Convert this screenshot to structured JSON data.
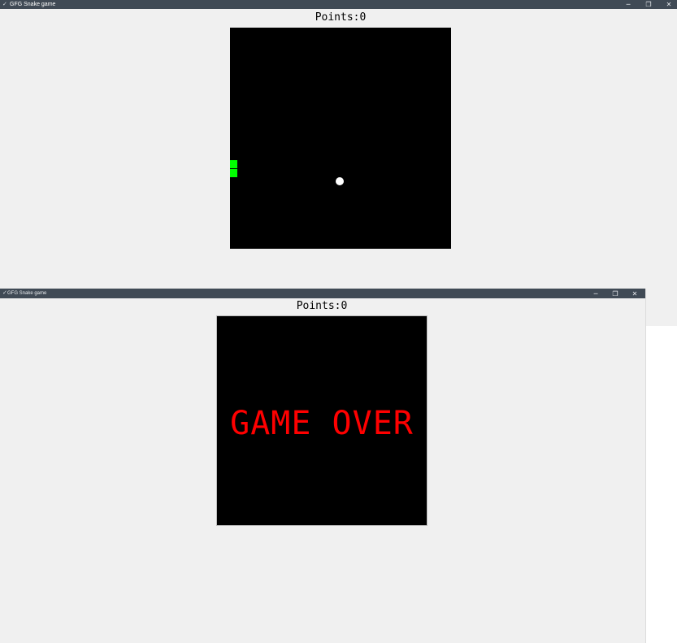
{
  "windows": [
    {
      "title": "GFG Snake game",
      "controls": {
        "minimize": "─",
        "maximize": "❐",
        "close": "✕"
      },
      "score_text": "Points:0",
      "colors": {
        "titlebar": "#404a55",
        "canvas": "#000000",
        "snake": "#00ff00",
        "food": "#ffffff"
      }
    },
    {
      "title": "GFG Snake game",
      "controls": {
        "minimize": "─",
        "maximize": "❐",
        "close": "✕"
      },
      "score_text": "Points:0",
      "message": "GAME OVER",
      "colors": {
        "titlebar": "#404a55",
        "canvas": "#000000",
        "message": "#ff0000"
      }
    }
  ]
}
